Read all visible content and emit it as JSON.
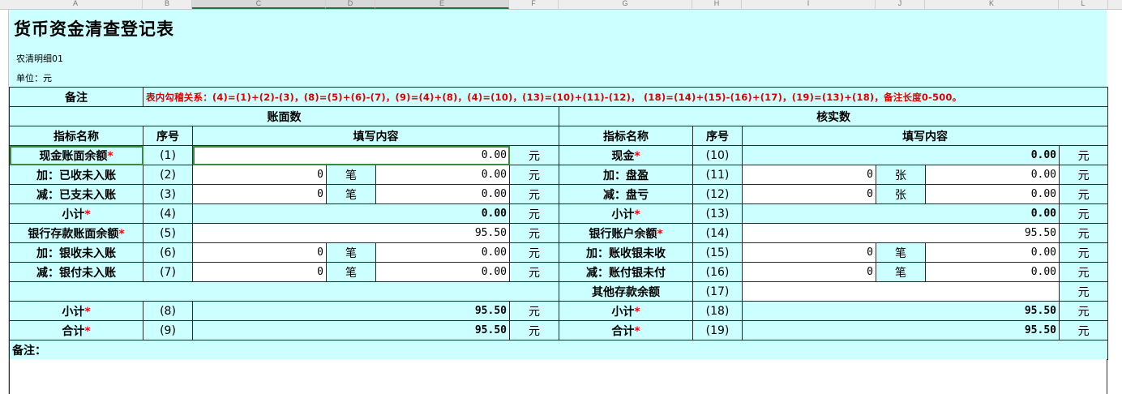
{
  "columns": [
    "A",
    "B",
    "C",
    "D",
    "E",
    "F",
    "G",
    "H",
    "I",
    "J",
    "K",
    "L"
  ],
  "sheet": {
    "title": "货币资金清查登记表",
    "subtitle": "农清明细01",
    "unit": "单位：元",
    "remark_label": "备注",
    "rule_text": "表内勾稽关系：(4)=(1)+(2)-(3)，(8)=(5)+(6)-(7)，(9)=(4)+(8)，(4)=(10)，(13)=(10)+(11)-(12)， (18)=(14)+(15)-(16)+(17)，(19)=(13)+(18)，备注长度0-500。",
    "left_header": "账面数",
    "right_header": "核实数",
    "h_name": "指标名称",
    "h_seq": "序号",
    "h_fill": "填写内容",
    "star": "*",
    "yuan": "元",
    "bi": "笔",
    "zhang": "张",
    "footer_remark": "备注：",
    "left_rows": {
      "cash": {
        "name": "现金账面余额",
        "seq": "(1)",
        "value": "0.00"
      },
      "recv": {
        "name": "加：已收未入账",
        "seq": "(2)",
        "count": "0",
        "value": "0.00"
      },
      "paid": {
        "name": "减：已支未入账",
        "seq": "(3)",
        "count": "0",
        "value": "0.00"
      },
      "sub1": {
        "name": "小计",
        "seq": "(4)",
        "value": "0.00"
      },
      "bank": {
        "name": "银行存款账面余额",
        "seq": "(5)",
        "value": "95.50"
      },
      "brecv": {
        "name": "加：银收未入账",
        "seq": "(6)",
        "count": "0",
        "value": "0.00"
      },
      "bpaid": {
        "name": "减：银付未入账",
        "seq": "(7)",
        "count": "0",
        "value": "0.00"
      },
      "sub2": {
        "name": "小计",
        "seq": "(8)",
        "value": "95.50"
      },
      "total": {
        "name": "合计",
        "seq": "(9)",
        "value": "95.50"
      }
    },
    "right_rows": {
      "cash": {
        "name": "现金",
        "seq": "(10)",
        "value": "0.00"
      },
      "surplus": {
        "name": "加：盘盈",
        "seq": "(11)",
        "count": "0",
        "value": "0.00"
      },
      "loss": {
        "name": "减：盘亏",
        "seq": "(12)",
        "count": "0",
        "value": "0.00"
      },
      "sub1": {
        "name": "小计",
        "seq": "(13)",
        "value": "0.00"
      },
      "bank": {
        "name": "银行账户余额",
        "seq": "(14)",
        "value": "95.50"
      },
      "arecv": {
        "name": "加：账收银未收",
        "seq": "(15)",
        "count": "0",
        "value": "0.00"
      },
      "apaid": {
        "name": "减：账付银未付",
        "seq": "(16)",
        "count": "0",
        "value": "0.00"
      },
      "other": {
        "name": "其他存款余额",
        "seq": "(17)",
        "value": ""
      },
      "sub2": {
        "name": "小计",
        "seq": "(18)",
        "value": "95.50"
      },
      "total": {
        "name": "合计",
        "seq": "(19)",
        "value": "95.50"
      }
    }
  }
}
